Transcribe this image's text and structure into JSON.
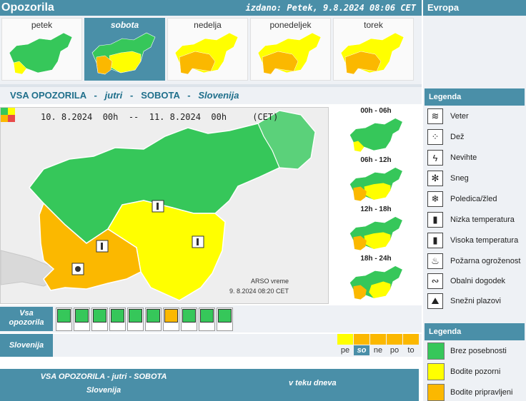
{
  "header": {
    "title": "Opozorila",
    "issued": "izdano: Petek, 9.8.2024 08:06 CET",
    "europe_tab": "Evropa"
  },
  "days": [
    {
      "label": "petek",
      "active": false,
      "level_counts": "mostly-green"
    },
    {
      "label": "sobota",
      "active": true,
      "level_counts": "mixed"
    },
    {
      "label": "nedelja",
      "active": false,
      "level_counts": "yellow-orange"
    },
    {
      "label": "ponedeljek",
      "active": false,
      "level_counts": "yellow-orange"
    },
    {
      "label": "torek",
      "active": false,
      "level_counts": "yellow-orange"
    }
  ],
  "title_bar": {
    "part1": "VSA OPOZORILA",
    "sep": " - ",
    "part2": "jutri",
    "part3": "SOBOTA",
    "part4": "Slovenija"
  },
  "map": {
    "period_text": "10. 8.2024  00h  --  11. 8.2024  00h     (CET)",
    "credit_line1": "ARSO vreme",
    "credit_line2": "9. 8.2024  08:20 CET"
  },
  "slots": [
    {
      "label": "00h - 06h"
    },
    {
      "label": "06h - 12h"
    },
    {
      "label": "12h - 18h"
    },
    {
      "label": "18h - 24h"
    }
  ],
  "rows": {
    "all_warnings_label_1": "Vsa",
    "all_warnings_label_2": "opozorila",
    "region_label": "Slovenija"
  },
  "warning_icons": [
    {
      "name": "wind-icon",
      "level": "green"
    },
    {
      "name": "rain-icon",
      "level": "green"
    },
    {
      "name": "thunderstorm-icon",
      "level": "green"
    },
    {
      "name": "snow-icon",
      "level": "green"
    },
    {
      "name": "ice-icon",
      "level": "green"
    },
    {
      "name": "low-temperature-icon",
      "level": "green"
    },
    {
      "name": "high-temperature-icon",
      "level": "orange"
    },
    {
      "name": "fire-danger-icon",
      "level": "green"
    },
    {
      "name": "coastal-event-icon",
      "level": "green"
    },
    {
      "name": "avalanche-icon",
      "level": "green"
    }
  ],
  "day_bars": [
    {
      "label": "pe",
      "color": "#ffff00",
      "active": false
    },
    {
      "label": "so",
      "color": "#fbb800",
      "active": true
    },
    {
      "label": "ne",
      "color": "#fbb800",
      "active": false
    },
    {
      "label": "po",
      "color": "#fbb800",
      "active": false
    },
    {
      "label": "to",
      "color": "#fbb800",
      "active": false
    }
  ],
  "footer": {
    "line1": "VSA OPOZORILA - jutri - SOBOTA",
    "line2": "Slovenija",
    "during_day": "v teku dneva"
  },
  "legend_types": {
    "title": "Legenda",
    "items": [
      {
        "label": "Veter",
        "icon": "wind-icon"
      },
      {
        "label": "Dež",
        "icon": "rain-icon"
      },
      {
        "label": "Nevihte",
        "icon": "thunderstorm-icon"
      },
      {
        "label": "Sneg",
        "icon": "snow-icon"
      },
      {
        "label": "Poledica/žled",
        "icon": "ice-icon"
      },
      {
        "label": "Nizka temperatura",
        "icon": "low-temperature-icon"
      },
      {
        "label": "Visoka temperatura",
        "icon": "high-temperature-icon"
      },
      {
        "label": "Požarna ogroženost",
        "icon": "fire-danger-icon"
      },
      {
        "label": "Obalni dogodek",
        "icon": "coastal-event-icon"
      },
      {
        "label": "Snežni plazovi",
        "icon": "avalanche-icon"
      }
    ]
  },
  "legend_levels": {
    "title": "Legenda",
    "items": [
      {
        "label": "Brez posebnosti",
        "color": "#36c75a"
      },
      {
        "label": "Bodite pozorni",
        "color": "#ffff00"
      },
      {
        "label": "Bodite pripravljeni",
        "color": "#fbb800"
      }
    ]
  },
  "colors": {
    "accent": "#4a8fa8",
    "green": "#36c75a",
    "yellow": "#ffff00",
    "orange": "#fbb800"
  }
}
